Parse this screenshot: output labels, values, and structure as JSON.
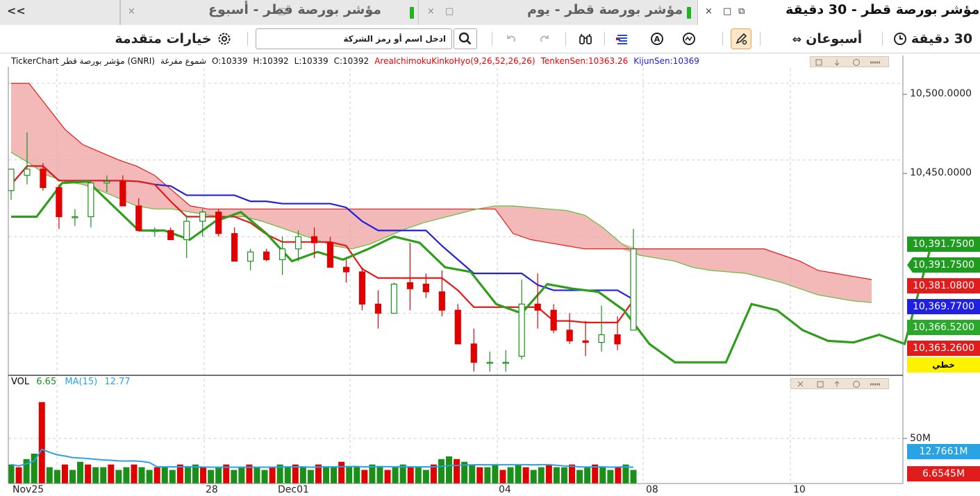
{
  "tabs": {
    "overflow": "<<",
    "items": [
      {
        "title": "مؤشر بورصة قطر - 30 دقيقة",
        "active": true
      },
      {
        "title": "مؤشر بورصة قطر - يوم",
        "active": false
      },
      {
        "title": "مؤشر بورصة قطر - أسبوع",
        "active": false
      }
    ]
  },
  "toolbar": {
    "interval": "30 دقيقة",
    "period": "أسبوعان",
    "advanced": "خيارات متقدمة",
    "search_placeholder": "ادخل اسم أو رمز الشركة"
  },
  "info": {
    "source": "TickerChart مؤشر بورصة قطر (GNRI)",
    "chart_style": "شموع مفرغة",
    "open": "O:10339",
    "high": "H:10392",
    "low": "L:10339",
    "close": "C:10392",
    "indicator": "AreaIchimokuKinkoHyo(9,26,52,26,26)",
    "tenkan": "TenkenSen:10363.26",
    "kijun": "KijunSen:10369"
  },
  "price_axis": {
    "ticks": [
      "10,500.0000",
      "10,450.0000"
    ],
    "boxes": [
      {
        "label": "10,391.7500",
        "color": "#1f9c1f"
      },
      {
        "label": "10,391.7500",
        "color": "#1f9c1f"
      },
      {
        "label": "10,381.0800",
        "color": "#e11c1c"
      },
      {
        "label": "10,369.7700",
        "color": "#2020e0"
      },
      {
        "label": "10,366.5200",
        "color": "#2aa82a"
      },
      {
        "label": "10,363.2600",
        "color": "#e11c1c"
      }
    ],
    "style_label": "خطي"
  },
  "volume": {
    "label": "VOL",
    "value": "6.65",
    "ma_label": "MA(15)",
    "ma_value": "12.77",
    "axis_tick": "50M",
    "boxes": [
      {
        "label": "12.7661M",
        "color": "#29a3e3"
      },
      {
        "label": "6.6545M",
        "color": "#e11c1c"
      }
    ]
  },
  "x_axis": {
    "labels": [
      "Nov25",
      "28",
      "Dec01",
      "04",
      "08",
      "10"
    ]
  },
  "colors": {
    "up": "#1a8f1a",
    "down": "#e00000",
    "kijun": "#2020e0",
    "tenkan": "#e31a1a",
    "chikou": "#2f9e1a",
    "cloud_bear": "#f0a8a8",
    "cloud_bull": "#b7e6a3",
    "ma": "#29a3e3"
  },
  "chart_data": {
    "type": "candlestick",
    "candles": [
      [
        10430,
        10444,
        10424,
        10444
      ],
      [
        10440,
        10468,
        10434,
        10444
      ],
      [
        10444,
        10448,
        10430,
        10432
      ],
      [
        10432,
        10434,
        10405,
        10413
      ],
      [
        10413,
        10418,
        10407,
        10413
      ],
      [
        10413,
        10437,
        10406,
        10435
      ],
      [
        10435,
        10440,
        10429,
        10436
      ],
      [
        10436,
        10440,
        10420,
        10420
      ],
      [
        10420,
        10425,
        10404,
        10404
      ],
      [
        10404,
        10406,
        10400,
        10404
      ],
      [
        10404,
        10406,
        10398,
        10398
      ],
      [
        10398,
        10414,
        10386,
        10410
      ],
      [
        10410,
        10418,
        10400,
        10416
      ],
      [
        10416,
        10418,
        10400,
        10402
      ],
      [
        10402,
        10406,
        10386,
        10384
      ],
      [
        10384,
        10392,
        10378,
        10390
      ],
      [
        10390,
        10392,
        10384,
        10385
      ],
      [
        10385,
        10400,
        10375,
        10392
      ],
      [
        10392,
        10404,
        10384,
        10400
      ],
      [
        10400,
        10406,
        10386,
        10396
      ],
      [
        10396,
        10400,
        10380,
        10380
      ],
      [
        10380,
        10385,
        10370,
        10377
      ],
      [
        10377,
        10380,
        10352,
        10356
      ],
      [
        10356,
        10365,
        10340,
        10350
      ],
      [
        10350,
        10370,
        10352,
        10369
      ],
      [
        10370,
        10396,
        10352,
        10366
      ],
      [
        10369,
        10376,
        10360,
        10364
      ],
      [
        10364,
        10378,
        10348,
        10352
      ],
      [
        10352,
        10356,
        10330,
        10330
      ],
      [
        10330,
        10340,
        10312,
        10318
      ],
      [
        10318,
        10325,
        10312,
        10318
      ],
      [
        10318,
        10326,
        10312,
        10318
      ],
      [
        10322,
        10372,
        10320,
        10356
      ],
      [
        10356,
        10376,
        10340,
        10352
      ],
      [
        10352,
        10356,
        10337,
        10339
      ],
      [
        10339,
        10350,
        10330,
        10332
      ],
      [
        10332,
        10345,
        10322,
        10331
      ],
      [
        10331,
        10355,
        10325,
        10336
      ],
      [
        10336,
        10348,
        10326,
        10330
      ],
      [
        10339,
        10405,
        10339,
        10392
      ]
    ],
    "ylim": [
      10310,
      10510
    ],
    "x_labels": [
      "Nov25",
      "28",
      "Dec01",
      "04",
      "08",
      "10"
    ],
    "volume_axis_tick": "50M"
  }
}
